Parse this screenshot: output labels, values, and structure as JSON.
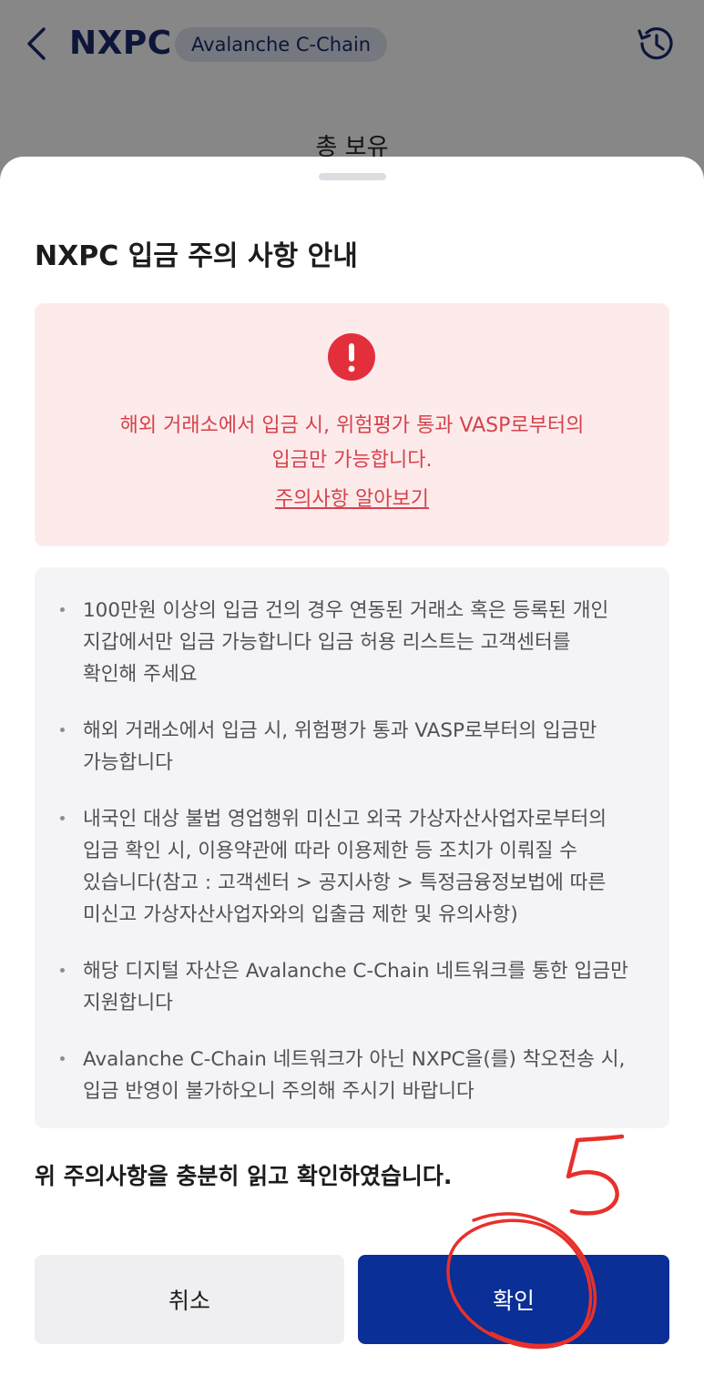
{
  "header": {
    "coin": "NXPC",
    "network_chip": "Avalanche C-Chain",
    "behind_label": "총 보유"
  },
  "modal": {
    "title": "NXPC 입금 주의 사항 안내",
    "warning": {
      "line1": "해외 거래소에서 입금 시, 위험평가 통과 VASP로부터의",
      "line2": "입금만 가능합니다.",
      "link": "주의사항 알아보기"
    },
    "notes": [
      [
        "100만원 이상의 입금 건의 경우 연동된 거래소 혹은 등록된 개인",
        "지갑에서만 입금 가능합니다 입금 허용 리스트는 고객센터를",
        "확인해 주세요"
      ],
      [
        "해외 거래소에서 입금 시, 위험평가 통과 VASP로부터의 입금만",
        "가능합니다"
      ],
      [
        "내국인 대상 불법 영업행위 미신고 외국 가상자산사업자로부터의",
        "입금 확인 시, 이용약관에 따라 이용제한 등 조치가 이뤄질 수",
        "있습니다(참고 : 고객센터 > 공지사항 > 특정금융정보법에 따른",
        "미신고 가상자산사업자와의 입출금 제한 및 유의사항)"
      ],
      [
        "해당 디지털 자산은 Avalanche C-Chain 네트워크를 통한 입금만",
        "지원합니다"
      ],
      [
        "Avalanche C-Chain 네트워크가 아닌 NXPC을(를) 착오전송 시,",
        "입금 반영이 불가하오니 주의해 주시기 바랍니다"
      ]
    ],
    "confirm_statement": "위 주의사항을 충분히 읽고 확인하였습니다.",
    "cancel_label": "취소",
    "ok_label": "확인"
  },
  "annotation": {
    "mark": "5",
    "color": "#e8302b"
  },
  "colors": {
    "primary": "#0a2f96",
    "warning_text": "#d6424b",
    "warning_bg": "#fdebec",
    "notes_bg": "#f4f4f6"
  }
}
